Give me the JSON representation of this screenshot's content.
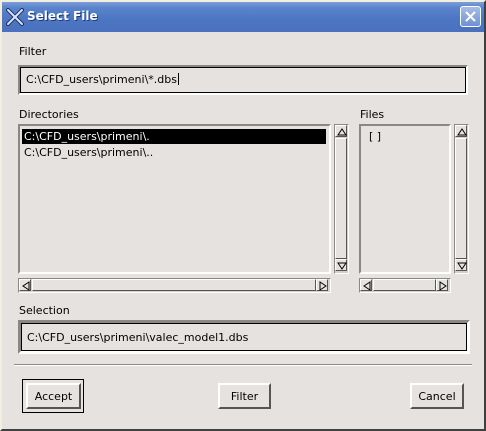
{
  "window": {
    "title": "Select File",
    "title_icon": "x-logo-icon",
    "close_icon": "close-icon"
  },
  "filter": {
    "label": "Filter",
    "value": "C:\\CFD_users\\primeni\\*.dbs"
  },
  "directories": {
    "label": "Directories",
    "items": [
      {
        "text": "C:\\CFD_users\\primeni\\.",
        "selected": true
      },
      {
        "text": "C:\\CFD_users\\primeni\\..",
        "selected": false
      }
    ]
  },
  "files": {
    "label": "Files",
    "items": [
      {
        "text": "[   ]",
        "selected": false
      }
    ]
  },
  "selection": {
    "label": "Selection",
    "value": "C:\\CFD_users\\primeni\\valec_model1.dbs"
  },
  "buttons": {
    "accept": "Accept",
    "filter": "Filter",
    "cancel": "Cancel"
  }
}
